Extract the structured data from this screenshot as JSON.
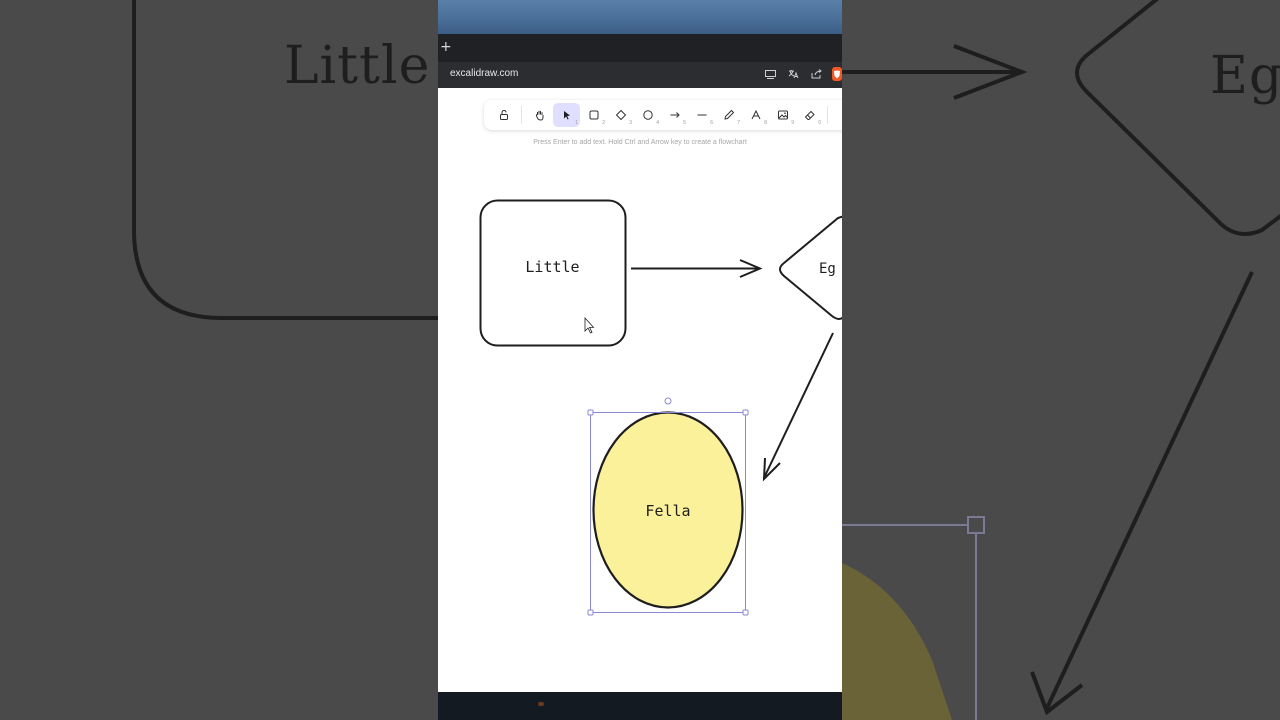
{
  "browser": {
    "new_tab_label": "+",
    "url": "excalidraw.com",
    "icons": [
      "cast-icon",
      "translate-icon",
      "share-icon",
      "brave-shield-icon"
    ]
  },
  "toolbar": {
    "tools": [
      {
        "name": "lock-tool",
        "key": ""
      },
      {
        "name": "hand-tool",
        "key": ""
      },
      {
        "name": "selection-tool",
        "key": "1",
        "active": true
      },
      {
        "name": "rectangle-tool",
        "key": "2"
      },
      {
        "name": "diamond-tool",
        "key": "3"
      },
      {
        "name": "ellipse-tool",
        "key": "4"
      },
      {
        "name": "arrow-tool",
        "key": "5"
      },
      {
        "name": "line-tool",
        "key": "6"
      },
      {
        "name": "draw-tool",
        "key": "7"
      },
      {
        "name": "text-tool",
        "key": "8"
      },
      {
        "name": "image-tool",
        "key": "9"
      },
      {
        "name": "eraser-tool",
        "key": "0"
      }
    ]
  },
  "hint": "Press Enter to add text. Hold Ctrl and Arrow key to create a flowchart",
  "canvas": {
    "rectangle_label": "Little",
    "diamond_label": "Eg",
    "ellipse_label": "Fella",
    "ellipse_fill": "#fbf19b",
    "selection_color": "#8b87d8"
  },
  "backdrop": {
    "left_text": "Little",
    "right_text": "Eg"
  }
}
